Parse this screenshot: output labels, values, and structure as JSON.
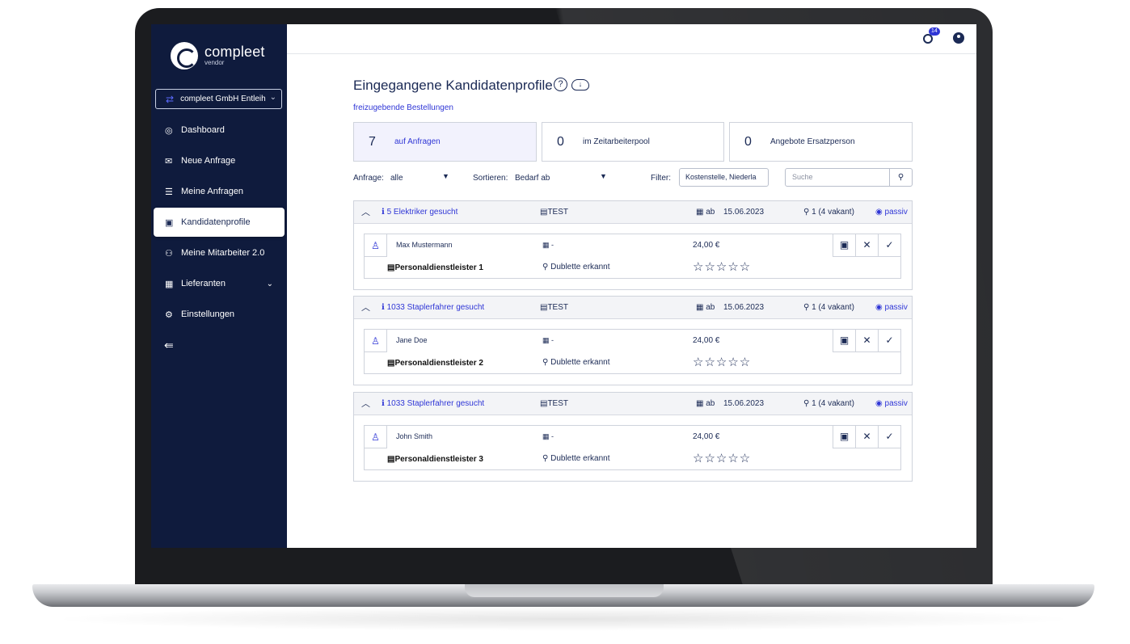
{
  "app": {
    "logo_name": "compleet",
    "logo_sub": "vendor"
  },
  "tenant": {
    "label": "compleet GmbH Entleih"
  },
  "sidebar": {
    "items": [
      {
        "label": "Dashboard",
        "icon": "◎"
      },
      {
        "label": "Neue Anfrage",
        "icon": "✉"
      },
      {
        "label": "Meine Anfragen",
        "icon": "☰"
      },
      {
        "label": "Kandidatenprofile",
        "icon": "▣"
      },
      {
        "label": "Meine Mitarbeiter 2.0",
        "icon": "⚇"
      },
      {
        "label": "Lieferanten",
        "icon": "▦"
      },
      {
        "label": "Einstellungen",
        "icon": "⚙"
      }
    ],
    "active": "Kandidatenprofile"
  },
  "topbar": {
    "notifications": "14"
  },
  "page": {
    "title": "Eingegangene Kandidatenprofile",
    "sublink": "freizugebende Bestellungen"
  },
  "stats": [
    {
      "num": "7",
      "label": "auf Anfragen"
    },
    {
      "num": "0",
      "label": "im Zeitarbeiterpool"
    },
    {
      "num": "0",
      "label": "Angebote Ersatzperson"
    }
  ],
  "filters": {
    "anfrage_label": "Anfrage:",
    "anfrage_value": "alle",
    "sort_label": "Sortieren:",
    "sort_value": "Bedarf ab",
    "filter_label": "Filter:",
    "filter_value": "Kostenstelle, Niederla",
    "search_placeholder": "Suche"
  },
  "cards": [
    {
      "title": "5 Elektriker gesucht",
      "tag": "TEST",
      "ab": "ab",
      "date": "15.06.2023",
      "vakant": "1 (4 vakant)",
      "status": "passiv",
      "candidate": {
        "name": "Max Mustermann",
        "cal": "-",
        "price": "24,00 €",
        "provider": "Personaldienstleister 1",
        "duplicate": "Dublette erkannt"
      }
    },
    {
      "title": "1033 Staplerfahrer gesucht",
      "tag": "TEST",
      "ab": "ab",
      "date": "15.06.2023",
      "vakant": "1 (4 vakant)",
      "status": "passiv",
      "candidate": {
        "name": "Jane Doe",
        "cal": "-",
        "price": "24,00 €",
        "provider": "Personaldienstleister 2",
        "duplicate": "Dublette erkannt"
      }
    },
    {
      "title": "1033 Staplerfahrer gesucht",
      "tag": "TEST",
      "ab": "ab",
      "date": "15.06.2023",
      "vakant": "1 (4 vakant)",
      "status": "passiv",
      "candidate": {
        "name": "John Smith",
        "cal": "-",
        "price": "24,00 €",
        "provider": "Personaldienstleister 3",
        "duplicate": "Dublette erkannt"
      }
    }
  ],
  "colors": {
    "sidebar_bg": "#0f1b3d",
    "accent": "#2f36d6",
    "text": "#1b2a55"
  }
}
